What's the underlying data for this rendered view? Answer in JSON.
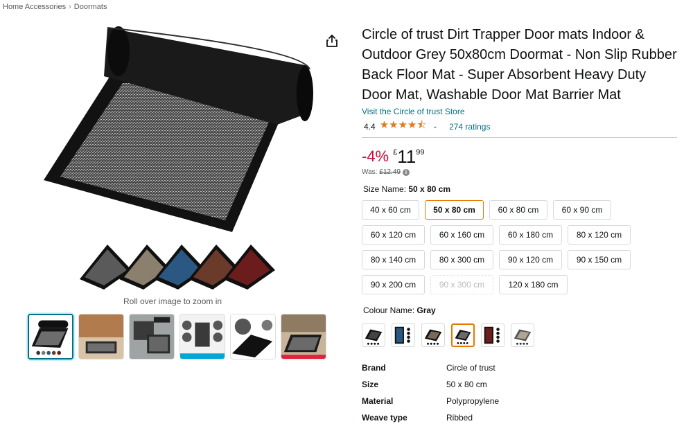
{
  "breadcrumb": {
    "items": [
      "Home Accessories",
      "Doormats"
    ],
    "sep": "›"
  },
  "gallery": {
    "zoom_hint": "Roll over image to zoom in"
  },
  "product": {
    "title": "Circle of trust Dirt Trapper Door mats Indoor & Outdoor Grey 50x80cm Doormat - Non Slip Rubber Back Floor Mat - Super Absorbent Heavy Duty Door Mat, Washable Door Mat Barrier Mat",
    "store_link": "Visit the Circle of trust Store",
    "rating": "4.4",
    "stars": "★★★★⯪",
    "chevron": "⌄",
    "ratings_count": "274 ratings"
  },
  "price": {
    "discount": "-4%",
    "currency": "£",
    "whole": "11",
    "fraction": "99",
    "was_label": "Was:",
    "was_price": "£12.49",
    "info": "i"
  },
  "size": {
    "label": "Size Name:",
    "selected": "50 x 80 cm",
    "options": [
      "40 x 60 cm",
      "50 x 80 cm",
      "60 x 80 cm",
      "60 x 90 cm",
      "60 x 120 cm",
      "60 x 160 cm",
      "60 x 180 cm",
      "80 x 120 cm",
      "80 x 140 cm",
      "80 x 300 cm",
      "90 x 120 cm",
      "90 x 150 cm",
      "90 x 200 cm",
      "90 x 300 cm",
      "120 x 180 cm"
    ]
  },
  "colour": {
    "label": "Colour Name:",
    "selected": "Gray"
  },
  "specs": [
    {
      "key": "Brand",
      "value": "Circle of trust"
    },
    {
      "key": "Size",
      "value": "50 x 80 cm"
    },
    {
      "key": "Material",
      "value": "Polypropylene"
    },
    {
      "key": "Weave type",
      "value": "Ribbed"
    }
  ],
  "colors": {
    "link": "#007185",
    "discount": "#cc0c39",
    "star": "#de7921",
    "selected_border": "#e77600"
  }
}
